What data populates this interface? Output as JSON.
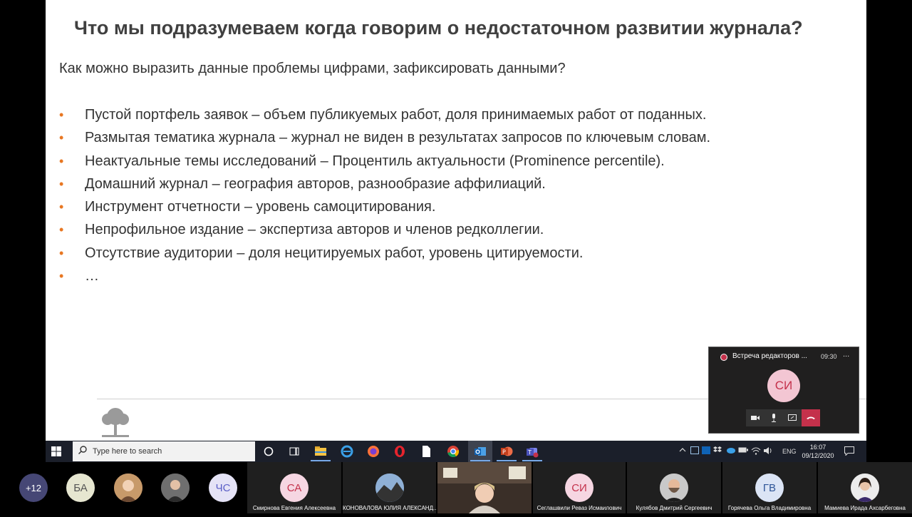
{
  "slide": {
    "title": "Что мы подразумеваем когда говорим о недостаточном развитии журнала?",
    "subtitle": "Как можно выразить данные проблемы цифрами, зафиксировать данными?",
    "bullet_marker": "•",
    "bullets": [
      "Пустой портфель заявок – объем публикуемых работ, доля принимаемых работ от поданных.",
      "Размытая тематика журнала – журнал не виден в результатах запросов по ключевым словам.",
      "Неактуальные темы исследований – Процентиль актуальности (Prominence percentile).",
      "Домашний журнал – география авторов, разнообразие аффилиаций.",
      "Инструмент отчетности – уровень самоцитирования.",
      "Непрофильное издание – экспертиза авторов и членов редколлегии.",
      "Отсутствие аудитории – доля нецитируемых работ, уровень цитируемости.",
      "…"
    ],
    "bullet_color": "#e87722"
  },
  "meeting_mini": {
    "title": "Встреча редакторов ...",
    "duration": "09:30",
    "more": "...",
    "avatar_initials": "СИ"
  },
  "taskbar": {
    "search_placeholder": "Type here to search",
    "language": "ENG",
    "time": "16:07",
    "date": "09/12/2020"
  },
  "participants": {
    "overflow": "+12",
    "initials": [
      {
        "initials": "БА",
        "color": "#e6e6d0",
        "text_color": "#555"
      },
      {
        "initials": "ЧС",
        "color": "#e5e3f6",
        "text_color": "#5b5fc7"
      }
    ],
    "named": [
      {
        "initials": "СА",
        "name": "Смирнова Евгения Алексеевна",
        "color": "#f6d6e2",
        "text_color": "#c4314b"
      },
      {
        "initials": "",
        "name": "КОНОВАЛОВА ЮЛИЯ АЛЕКСАНД...",
        "color": "#555",
        "text_color": "#fff"
      },
      {
        "initials": "СИ",
        "name": "Сеглашвили Реваз Исмаилович",
        "color": "#f6d6e2",
        "text_color": "#c4314b"
      },
      {
        "initials": "",
        "name": "Кулябов Дмитрий Сергеевич",
        "color": "#777",
        "text_color": "#fff"
      },
      {
        "initials": "ГВ",
        "name": "Горячева Ольга Владимировна",
        "color": "#dbe4f5",
        "text_color": "#2f5597"
      },
      {
        "initials": "",
        "name": "Мамиева Ирада Ахсарбеговна",
        "color": "#888",
        "text_color": "#fff"
      }
    ]
  }
}
